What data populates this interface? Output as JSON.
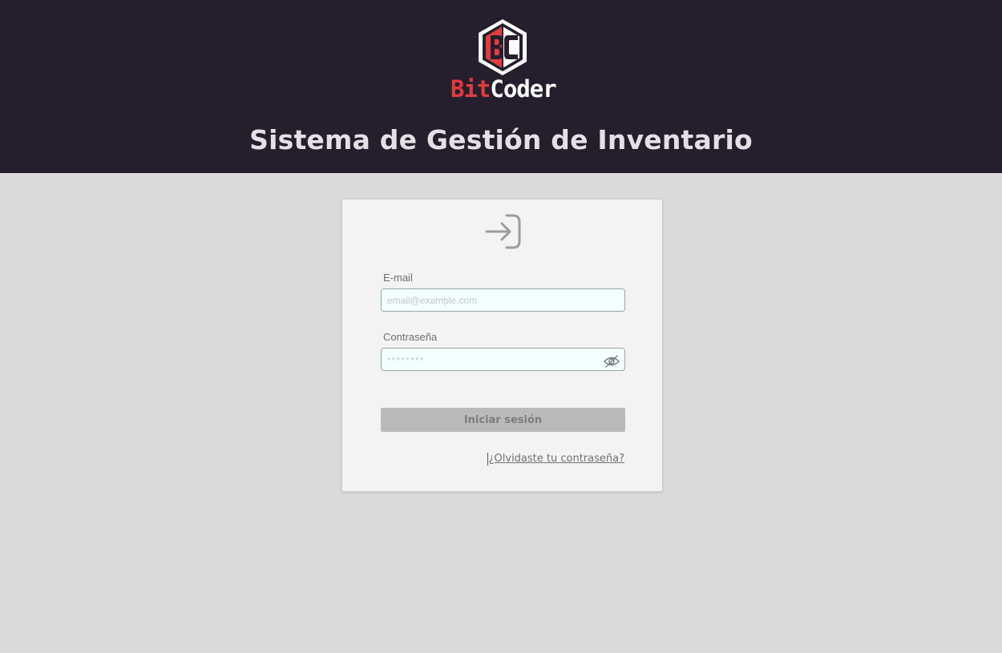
{
  "header": {
    "logo": {
      "monogram": "BC",
      "brand_part1": "Bit",
      "brand_part2": "Coder"
    },
    "title": "Sistema de Gestión de Inventario"
  },
  "login_form": {
    "icon": "login-arrow-icon",
    "email": {
      "label": "E-mail",
      "placeholder": "email@example.com",
      "value": ""
    },
    "password": {
      "label": "Contraseña",
      "placeholder": "********",
      "value": "",
      "toggle_icon": "eye-off-icon"
    },
    "submit_label": "Iniciar sesión",
    "forgot_link": "¿Olvidaste tu contraseña?"
  },
  "colors": {
    "header_bg": "#251f2d",
    "page_bg": "#dadada",
    "brand_red": "#e43a3f",
    "card_bg": "#f2f3f2",
    "button_bg": "#bababa"
  }
}
